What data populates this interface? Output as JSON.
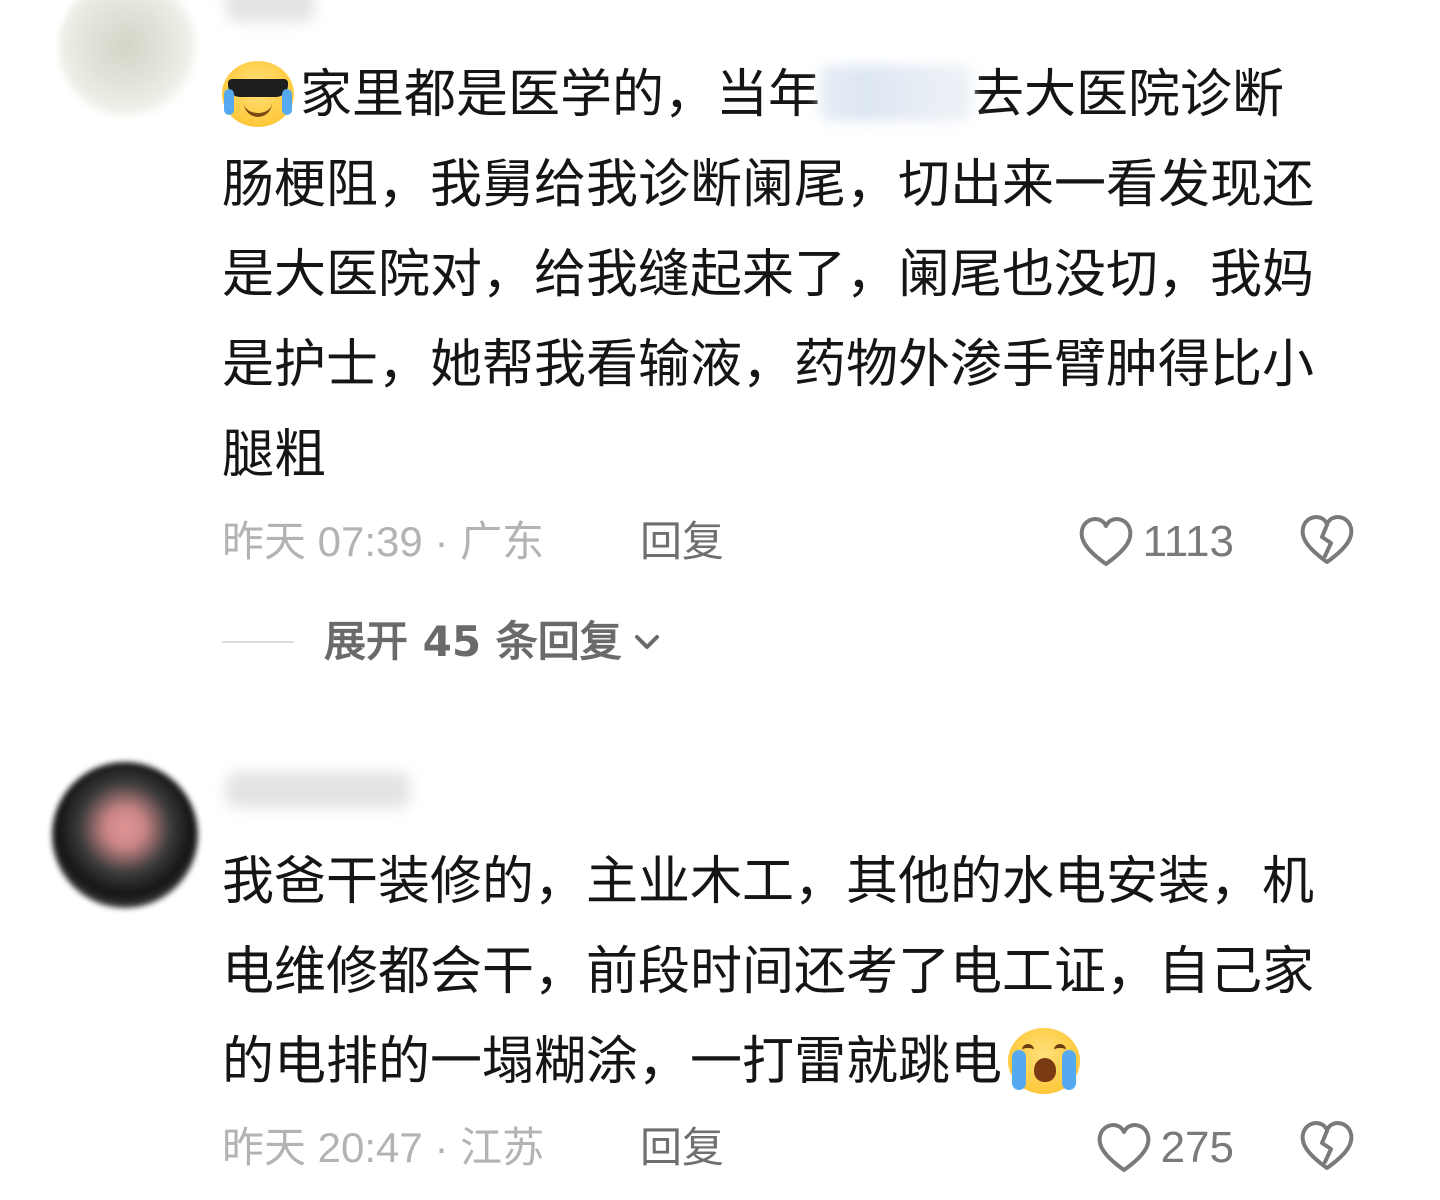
{
  "comments": [
    {
      "username": "",
      "emoji_start": "sunglasses-crying-emoji",
      "lines": [
        {
          "before": "家里都是医学的，当年",
          "after": "去大医院诊断"
        },
        "肠梗阻，我舅给我诊断阑尾，切出来一看发现还",
        "是大医院对，给我缝起来了，阑尾也没切，我妈",
        "是护士，她帮我看输液，药物外渗手臂肿得比小",
        "腿粗"
      ],
      "time_location": "昨天 07:39 · 广东",
      "reply_label": "回复",
      "likes": "1113",
      "expand_label": "展开 45 条回复"
    },
    {
      "username": "",
      "lines": [
        "我爸干装修的，主业木工，其他的水电安装，机",
        "电维修都会干，前段时间还考了电工证，自己家",
        "的电排的一塌糊涂，一打雷就跳电"
      ],
      "emoji_end": "loudly-crying-emoji",
      "time_location": "昨天 20:47 · 江苏",
      "reply_label": "回复",
      "likes": "275"
    }
  ],
  "colors": {
    "text": "#151515",
    "meta": "#b3b3b3",
    "reply": "#6f6f6f",
    "icon": "#7a7a7a"
  }
}
